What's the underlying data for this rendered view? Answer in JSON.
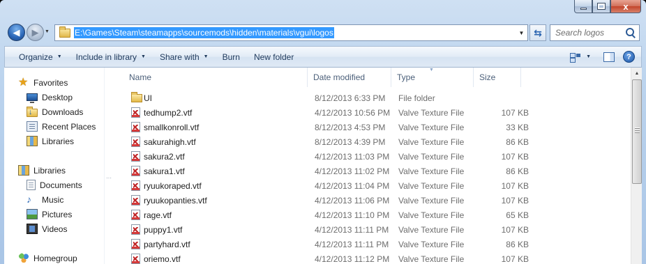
{
  "window": {
    "caption_buttons": {
      "minimize_icon": "minimize-icon",
      "maximize_icon": "maximize-icon",
      "close_glyph": "x"
    }
  },
  "address_bar": {
    "path": "E:\\Games\\Steam\\steamapps\\sourcemods\\hidden\\materials\\vgui\\logos",
    "dropdown_glyph": "▼",
    "refresh_glyph": "⇆"
  },
  "search": {
    "placeholder": "Search logos",
    "value": ""
  },
  "toolbar": {
    "organize": "Organize",
    "include_in_library": "Include in library",
    "share_with": "Share with",
    "burn": "Burn",
    "new_folder": "New folder",
    "caret": "▼",
    "help": "?"
  },
  "nav_pane": {
    "favorites": {
      "label": "Favorites",
      "items": [
        {
          "label": "Desktop",
          "icon": "desktop-icon"
        },
        {
          "label": "Downloads",
          "icon": "downloads-icon"
        },
        {
          "label": "Recent Places",
          "icon": "recent-places-icon"
        },
        {
          "label": "Libraries",
          "icon": "libraries-icon"
        }
      ]
    },
    "libraries": {
      "label": "Libraries",
      "items": [
        {
          "label": "Documents",
          "icon": "documents-icon"
        },
        {
          "label": "Music",
          "icon": "music-icon"
        },
        {
          "label": "Pictures",
          "icon": "pictures-icon"
        },
        {
          "label": "Videos",
          "icon": "videos-icon"
        }
      ]
    },
    "homegroup": {
      "label": "Homegroup"
    }
  },
  "file_list": {
    "columns": {
      "name": "Name",
      "date_modified": "Date modified",
      "type": "Type",
      "size": "Size"
    },
    "rows": [
      {
        "name": "UI",
        "date": "8/12/2013 6:33 PM",
        "type": "File folder",
        "size": "",
        "icon": "folder-icon"
      },
      {
        "name": "tedhump2.vtf",
        "date": "4/12/2013 10:56 PM",
        "type": "Valve Texture File",
        "size": "107 KB",
        "icon": "vtf-file-icon"
      },
      {
        "name": "smallkonroll.vtf",
        "date": "8/12/2013 4:53 PM",
        "type": "Valve Texture File",
        "size": "33 KB",
        "icon": "vtf-file-icon"
      },
      {
        "name": "sakurahigh.vtf",
        "date": "8/12/2013 4:39 PM",
        "type": "Valve Texture File",
        "size": "86 KB",
        "icon": "vtf-file-icon"
      },
      {
        "name": "sakura2.vtf",
        "date": "4/12/2013 11:03 PM",
        "type": "Valve Texture File",
        "size": "107 KB",
        "icon": "vtf-file-icon"
      },
      {
        "name": "sakura1.vtf",
        "date": "4/12/2013 11:02 PM",
        "type": "Valve Texture File",
        "size": "86 KB",
        "icon": "vtf-file-icon"
      },
      {
        "name": "ryuukoraped.vtf",
        "date": "4/12/2013 11:04 PM",
        "type": "Valve Texture File",
        "size": "107 KB",
        "icon": "vtf-file-icon"
      },
      {
        "name": "ryuukopanties.vtf",
        "date": "4/12/2013 11:06 PM",
        "type": "Valve Texture File",
        "size": "107 KB",
        "icon": "vtf-file-icon"
      },
      {
        "name": "rage.vtf",
        "date": "4/12/2013 11:10 PM",
        "type": "Valve Texture File",
        "size": "65 KB",
        "icon": "vtf-file-icon"
      },
      {
        "name": "puppy1.vtf",
        "date": "4/12/2013 11:11 PM",
        "type": "Valve Texture File",
        "size": "107 KB",
        "icon": "vtf-file-icon"
      },
      {
        "name": "partyhard.vtf",
        "date": "4/12/2013 11:11 PM",
        "type": "Valve Texture File",
        "size": "86 KB",
        "icon": "vtf-file-icon"
      },
      {
        "name": "oriemo.vtf",
        "date": "4/12/2013 11:12 PM",
        "type": "Valve Texture File",
        "size": "107 KB",
        "icon": "vtf-file-icon"
      }
    ]
  },
  "colors": {
    "selection_blue": "#3399ff",
    "toolbar_text": "#1e395b",
    "header_text": "#4c607a",
    "secondary_text": "#6d6d6d"
  }
}
